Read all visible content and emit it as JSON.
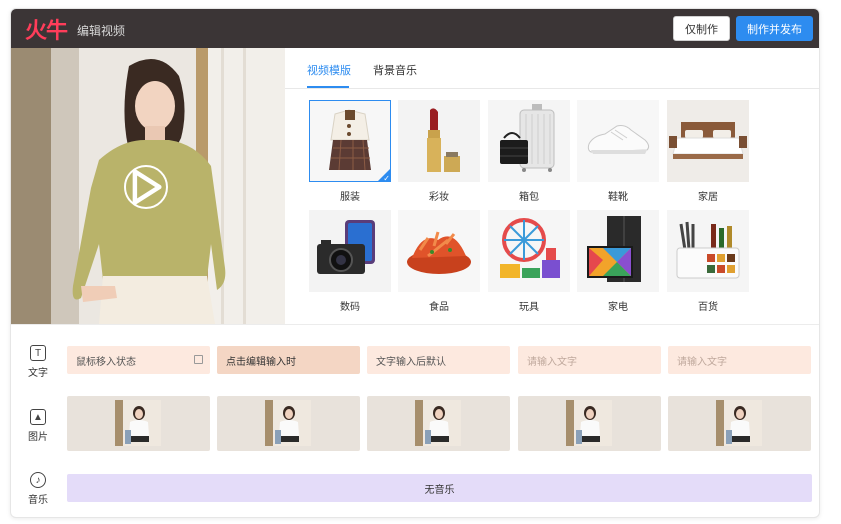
{
  "header": {
    "logo": "火牛",
    "title": "编辑视频",
    "make_only": "仅制作",
    "make_publish": "制作并发布"
  },
  "tabs": [
    {
      "label": "视频模版",
      "active": true
    },
    {
      "label": "背景音乐",
      "active": false
    }
  ],
  "categories": [
    {
      "label": "服装",
      "icon": "clothing-icon",
      "selected": true
    },
    {
      "label": "彩妆",
      "icon": "lipstick-icon"
    },
    {
      "label": "箱包",
      "icon": "luggage-icon"
    },
    {
      "label": "鞋靴",
      "icon": "sneaker-icon"
    },
    {
      "label": "家居",
      "icon": "bed-icon"
    },
    {
      "label": "数码",
      "icon": "camera-icon"
    },
    {
      "label": "食品",
      "icon": "snack-icon"
    },
    {
      "label": "玩具",
      "icon": "toy-icon"
    },
    {
      "label": "家电",
      "icon": "tv-icon"
    },
    {
      "label": "百货",
      "icon": "kitchen-rack-icon"
    }
  ],
  "rows": {
    "text_label": "文字",
    "image_label": "图片",
    "music_label": "音乐"
  },
  "text_boxes": [
    {
      "text": "鼠标移入状态"
    },
    {
      "text": "点击编辑输入时"
    },
    {
      "text": "文字输入后默认"
    },
    {
      "text": "请输入文字"
    },
    {
      "text": "请输入文字"
    }
  ],
  "music": {
    "text": "无音乐"
  },
  "colors": {
    "header_bg": "#3b3536",
    "brand": "#ff3d5a",
    "accent": "#2d8cf0",
    "text_box": "#fde9df",
    "music_bar": "#e4dcf9"
  }
}
